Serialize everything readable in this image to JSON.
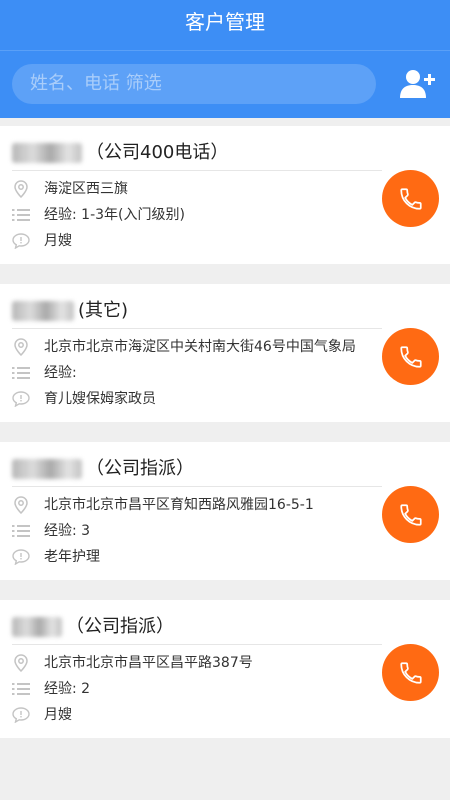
{
  "header": {
    "title": "客户管理",
    "search_placeholder": "姓名、电话 筛选"
  },
  "customers": [
    {
      "name_suffix": "（公司400电话）",
      "address": "海淀区西三旗",
      "experience": "经验:  1-3年(入门级别)",
      "service": "月嫂"
    },
    {
      "name_suffix": "(其它)",
      "address": "北京市北京市海淀区中关村南大街46号中国气象局",
      "experience": "经验:",
      "service": "育儿嫂保姆家政员"
    },
    {
      "name_suffix": "（公司指派）",
      "address": "北京市北京市昌平区育知西路风雅园16-5-1",
      "experience": "经验:  3",
      "service": "老年护理"
    },
    {
      "name_suffix": "（公司指派）",
      "address": "北京市北京市昌平区昌平路387号",
      "experience": "经验:  2",
      "service": "月嫂"
    }
  ],
  "colors": {
    "header": "#3d8ef5",
    "call_button": "#ff6a13",
    "background": "#efefef"
  },
  "icons": [
    "add-user-icon",
    "location-pin-icon",
    "list-icon",
    "comment-icon",
    "phone-icon"
  ]
}
